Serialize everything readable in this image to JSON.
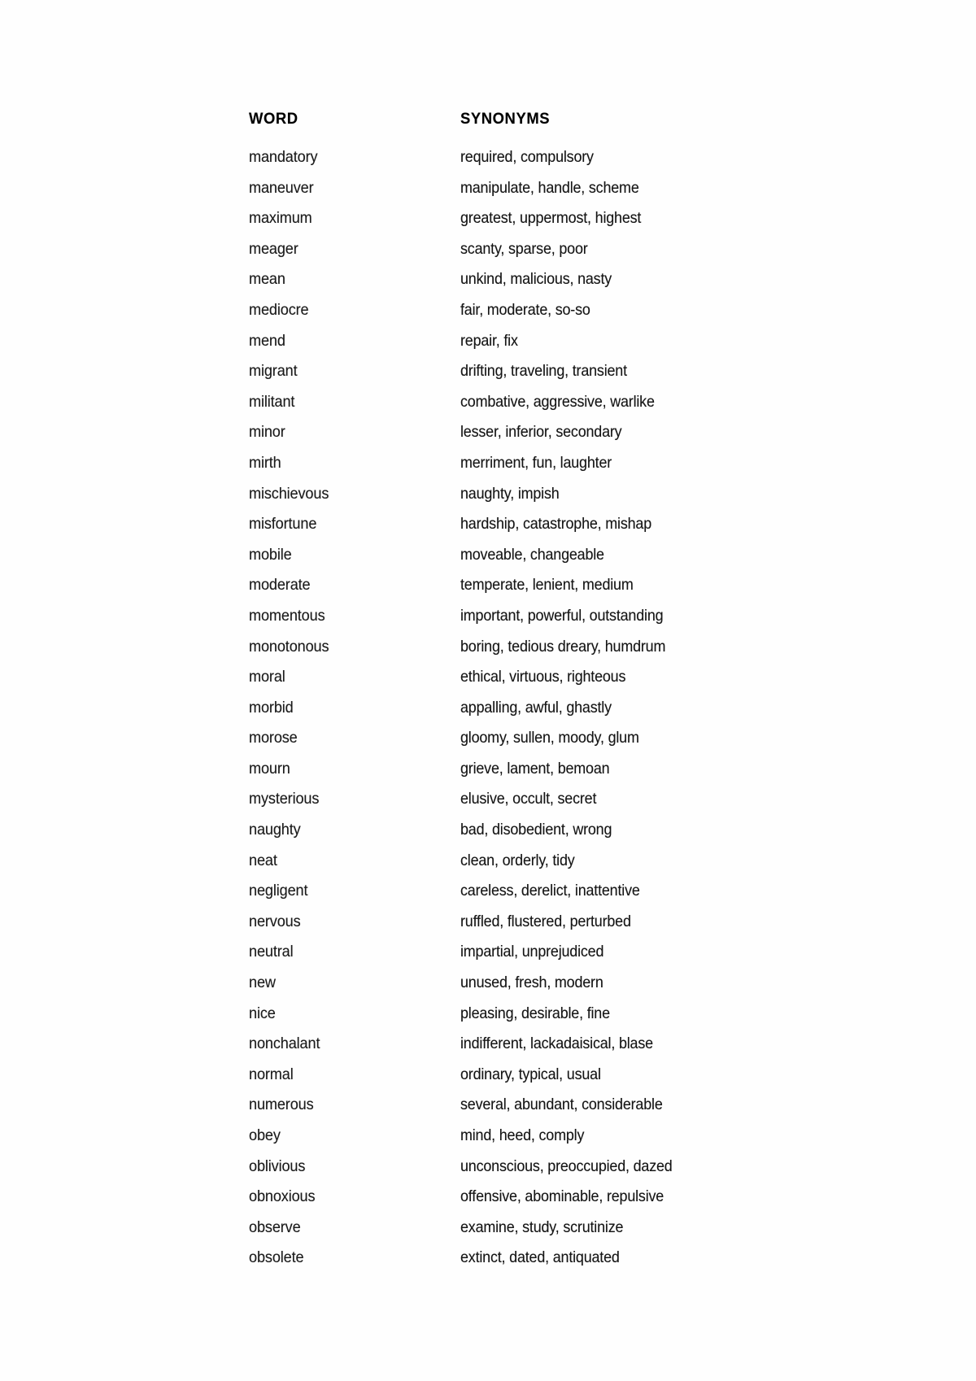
{
  "document": {
    "type": "glossary-page",
    "headers": {
      "word": "WORD",
      "synonyms": "SYNONYMS"
    },
    "entries": [
      {
        "word": "mandatory",
        "synonyms": "required, compulsory"
      },
      {
        "word": "maneuver",
        "synonyms": "manipulate, handle, scheme"
      },
      {
        "word": "maximum",
        "synonyms": "greatest, uppermost, highest"
      },
      {
        "word": "meager",
        "synonyms": "scanty, sparse, poor"
      },
      {
        "word": "mean",
        "synonyms": "unkind, malicious, nasty"
      },
      {
        "word": "mediocre",
        "synonyms": "fair, moderate, so-so"
      },
      {
        "word": "mend",
        "synonyms": "repair, fix"
      },
      {
        "word": "migrant",
        "synonyms": "drifting, traveling, transient"
      },
      {
        "word": "militant",
        "synonyms": "combative, aggressive, warlike"
      },
      {
        "word": "minor",
        "synonyms": "lesser, inferior, secondary"
      },
      {
        "word": "mirth",
        "synonyms": "merriment, fun, laughter"
      },
      {
        "word": "mischievous",
        "synonyms": "naughty, impish"
      },
      {
        "word": "misfortune",
        "synonyms": "hardship, catastrophe, mishap"
      },
      {
        "word": "mobile",
        "synonyms": "moveable, changeable"
      },
      {
        "word": "moderate",
        "synonyms": "temperate, lenient, medium"
      },
      {
        "word": "momentous",
        "synonyms": "important, powerful, outstanding"
      },
      {
        "word": "monotonous",
        "synonyms": "boring, tedious dreary, humdrum"
      },
      {
        "word": "moral",
        "synonyms": "ethical, virtuous, righteous"
      },
      {
        "word": "morbid",
        "synonyms": "appalling, awful, ghastly"
      },
      {
        "word": "morose",
        "synonyms": "gloomy, sullen, moody, glum"
      },
      {
        "word": "mourn",
        "synonyms": "grieve, lament, bemoan"
      },
      {
        "word": "mysterious",
        "synonyms": "elusive, occult, secret"
      },
      {
        "word": "naughty",
        "synonyms": "bad, disobedient, wrong"
      },
      {
        "word": "neat",
        "synonyms": "clean, orderly, tidy"
      },
      {
        "word": "negligent",
        "synonyms": "careless, derelict, inattentive"
      },
      {
        "word": "nervous",
        "synonyms": "ruffled, flustered, perturbed"
      },
      {
        "word": "neutral",
        "synonyms": "impartial, unprejudiced"
      },
      {
        "word": "new",
        "synonyms": "unused, fresh, modern"
      },
      {
        "word": "nice",
        "synonyms": "pleasing, desirable, fine"
      },
      {
        "word": "nonchalant",
        "synonyms": "indifferent, lackadaisical, blase"
      },
      {
        "word": "normal",
        "synonyms": "ordinary, typical, usual"
      },
      {
        "word": "numerous",
        "synonyms": "several, abundant, considerable"
      },
      {
        "word": "obey",
        "synonyms": "mind, heed, comply"
      },
      {
        "word": "oblivious",
        "synonyms": "unconscious, preoccupied, dazed"
      },
      {
        "word": "obnoxious",
        "synonyms": "offensive, abominable, repulsive"
      },
      {
        "word": "observe",
        "synonyms": "examine, study, scrutinize"
      },
      {
        "word": "obsolete",
        "synonyms": "extinct, dated, antiquated"
      }
    ]
  }
}
